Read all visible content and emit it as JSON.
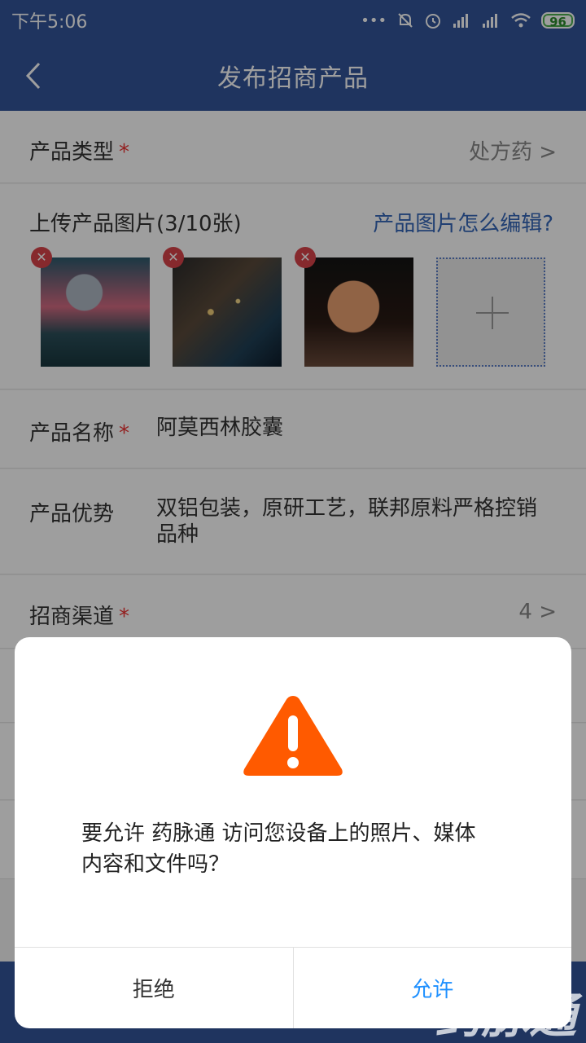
{
  "status": {
    "time": "下午5:06",
    "dots": "•••",
    "battery": "96"
  },
  "nav": {
    "title": "发布招商产品"
  },
  "form": {
    "product_type": {
      "label": "产品类型",
      "required": "*",
      "value": "处方药 >"
    },
    "images": {
      "label": "上传产品图片(3/10张)",
      "help_link": "产品图片怎么编辑?",
      "delete_glyph": "✕"
    },
    "product_name": {
      "label": "产品名称",
      "required": "*",
      "value": "阿莫西林胶囊"
    },
    "advantage": {
      "label": "产品优势",
      "value_line1": "双铝包装，原研工艺，联邦原料严格控销",
      "value_line2": "品种"
    },
    "channels": {
      "label": "招商渠道",
      "required": "*",
      "value": "4 >"
    }
  },
  "dialog": {
    "message_line1": "要允许 药脉通 访问您设备上的照片、媒体",
    "message_line2": "内容和文件吗？",
    "deny_label": "拒绝",
    "allow_label": "允许"
  },
  "watermark": "药脉通",
  "colors": {
    "primary": "#33559a",
    "accent_link": "#3466b8",
    "warning": "#ff5a00",
    "allow": "#1e90ff",
    "required": "#e33333"
  }
}
